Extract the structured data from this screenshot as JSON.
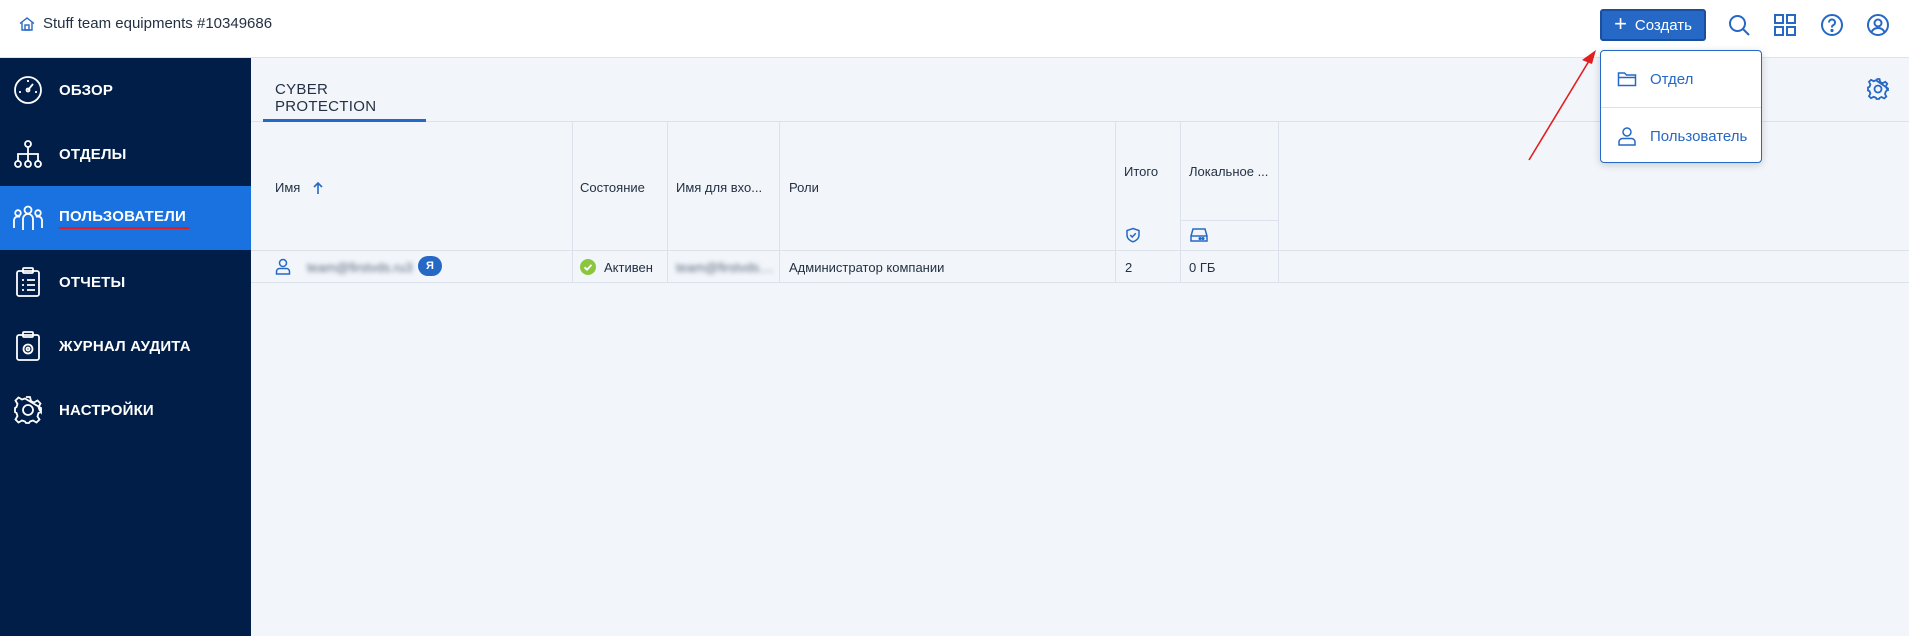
{
  "header": {
    "tenant_name": "Stuff team equipments #10349686",
    "create_label": "Создать"
  },
  "sidebar": {
    "items": [
      {
        "label": "ОБЗОР",
        "icon": "dashboard-gauge-icon"
      },
      {
        "label": "ОТДЕЛЫ",
        "icon": "org-tree-icon"
      },
      {
        "label": "ПОЛЬЗОВАТЕЛИ",
        "icon": "users-group-icon",
        "active": true
      },
      {
        "label": "ОТЧЕТЫ",
        "icon": "clipboard-report-icon"
      },
      {
        "label": "ЖУРНАЛ АУДИТА",
        "icon": "audit-log-icon"
      },
      {
        "label": "НАСТРОЙКИ",
        "icon": "gear-icon"
      }
    ]
  },
  "tabs": [
    {
      "label": "CYBER PROTECTION"
    }
  ],
  "table": {
    "columns": {
      "name": "Имя",
      "state": "Состояние",
      "login": "Имя для вхо...",
      "roles": "Роли",
      "total": "Итого",
      "local": "Локальное ..."
    },
    "rows": [
      {
        "name": "team@firstvds.ru3",
        "me_badge": "Я",
        "state": "Активен",
        "login": "team@firstvds....",
        "roles": "Администратор компании",
        "total": "2",
        "local": "0 ГБ"
      }
    ]
  },
  "dropdown": {
    "items": [
      {
        "label": "Отдел",
        "icon": "folder-icon"
      },
      {
        "label": "Пользователь",
        "icon": "user-icon"
      }
    ]
  },
  "colors": {
    "sidebar_bg": "#011e48",
    "active_item": "#1a72e0",
    "accent": "#2668c5",
    "status_ok": "#8cc63f",
    "annotation": "#e02020"
  }
}
